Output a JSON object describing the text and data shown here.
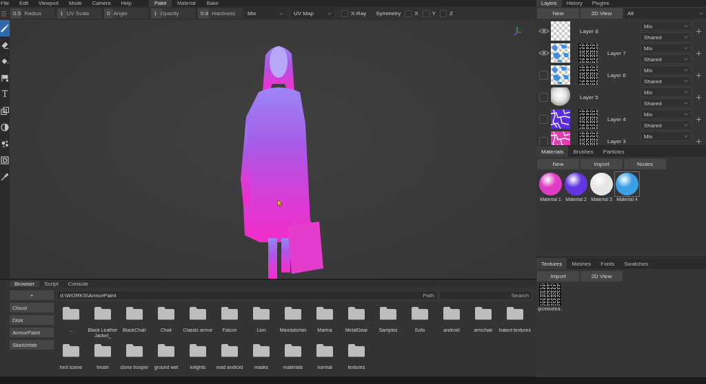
{
  "menu_bar": {
    "menus": [
      "File",
      "Edit",
      "Viewport",
      "Mode",
      "Camera",
      "Help"
    ],
    "tabs": [
      {
        "label": "Paint",
        "selected": true
      },
      {
        "label": "Material",
        "selected": false
      },
      {
        "label": "Bake",
        "selected": false
      }
    ]
  },
  "tool_options": {
    "sliders": [
      {
        "value": "0.5",
        "label": "Radius",
        "level": 0.25
      },
      {
        "value": "1",
        "label": "UV Scale",
        "level": 0.2
      },
      {
        "value": "0",
        "label": "Angle",
        "level": 0.2
      },
      {
        "value": "1",
        "label": "Opacity",
        "level": 0.25
      },
      {
        "value": "0.8",
        "label": "Hardness",
        "level": 0.25
      }
    ],
    "dropdowns": [
      {
        "value": "Mix"
      },
      {
        "value": "UV Map"
      }
    ],
    "xray": {
      "label": "X-Ray",
      "checked": false
    },
    "symmetry": {
      "label": "Symmetry",
      "axes": [
        {
          "label": "X",
          "checked": false
        },
        {
          "label": "Y",
          "checked": false
        },
        {
          "label": "Z",
          "checked": false
        }
      ]
    }
  },
  "toolbox": {
    "tools": [
      {
        "kind": "brush",
        "selected": true
      },
      {
        "kind": "eraser",
        "selected": false
      },
      {
        "kind": "fill",
        "selected": false
      },
      {
        "kind": "decal",
        "selected": false
      },
      {
        "kind": "text",
        "glyph": "T",
        "selected": false
      },
      {
        "kind": "clone",
        "selected": false
      },
      {
        "kind": "blur",
        "selected": false
      },
      {
        "kind": "particle",
        "selected": false
      },
      {
        "kind": "colorid",
        "selected": false
      },
      {
        "kind": "picker",
        "selected": false
      }
    ]
  },
  "layers_panel": {
    "tabs": [
      {
        "label": "Layers",
        "selected": true
      },
      {
        "label": "History",
        "selected": false
      },
      {
        "label": "Plugins",
        "selected": false
      }
    ],
    "buttons": [
      "New",
      "2D View"
    ],
    "filter": "All",
    "layers": [
      {
        "name": "Layer 8",
        "visible": true,
        "kind": "empty",
        "mask": false,
        "blend": "Mix",
        "object": "Shared"
      },
      {
        "name": "Layer 7",
        "visible": true,
        "kind": "paint",
        "color": "#3d8fe0",
        "mask": true,
        "blend": "Mix",
        "object": "Shared"
      },
      {
        "name": "Layer 6",
        "visible": false,
        "kind": "paint",
        "color": "#3d8fe0",
        "mask": true,
        "blend": "Mix",
        "object": "Shared"
      },
      {
        "name": "Layer 5",
        "visible": false,
        "kind": "sphere",
        "mask": false,
        "blend": "Mix",
        "object": "Shared"
      },
      {
        "name": "Layer 4",
        "visible": false,
        "kind": "fill",
        "color": "#5a2ee0",
        "mask": true,
        "blend": "Mix",
        "object": "Shared"
      },
      {
        "name": "Layer 3",
        "visible": false,
        "kind": "fill",
        "color": "#e03cb4",
        "mask": true,
        "blend": "Mix"
      }
    ]
  },
  "materials_panel": {
    "tabs": [
      {
        "label": "Materials",
        "selected": true
      },
      {
        "label": "Brushes",
        "selected": false
      },
      {
        "label": "Particles",
        "selected": false
      }
    ],
    "buttons": [
      "New",
      "Import",
      "Nodes"
    ],
    "materials": [
      {
        "name": "Material 1",
        "color": "#e03cc4",
        "selected": false
      },
      {
        "name": "Material 2",
        "color": "#6434e0",
        "selected": false
      },
      {
        "name": "Material 3",
        "color": "#e6e6e6",
        "selected": false
      },
      {
        "name": "Material 4",
        "color": "#3a9fe4",
        "selected": true
      }
    ]
  },
  "textures_panel": {
    "tabs": [
      {
        "label": "Textures",
        "selected": true
      },
      {
        "label": "Meshes",
        "selected": false
      },
      {
        "label": "Fonts",
        "selected": false
      },
      {
        "label": "Swatches",
        "selected": false
      }
    ],
    "buttons": [
      "Import",
      "2D View"
    ],
    "textures": [
      {
        "name": "qrcesueea.."
      }
    ]
  },
  "browser_panel": {
    "tabs": [
      {
        "label": "Browser",
        "selected": true
      },
      {
        "label": "Script",
        "selected": false
      },
      {
        "label": "Console",
        "selected": false
      }
    ],
    "sources": [
      "+",
      "Cloud",
      "Disk",
      "ArmorPaint",
      "Sketchfab"
    ],
    "path": {
      "value": "d:\\WORKS\\ArmorPaint",
      "label": "Path"
    },
    "search": {
      "placeholder": "Search"
    },
    "folders": [
      "..",
      "Black Leather Jacket_",
      "BlackChair",
      "Chair",
      "Classic armor",
      "Falcon",
      "Lion",
      "Mandalorian",
      "Marina",
      "MetalGear",
      "Samples",
      "Sofa",
      "android",
      "armchair",
      "baked textures",
      "bed scene",
      "brush",
      "clone trooper",
      "ground wet",
      "knights",
      "mad android",
      "masks",
      "materials",
      "normal",
      "textures"
    ]
  }
}
